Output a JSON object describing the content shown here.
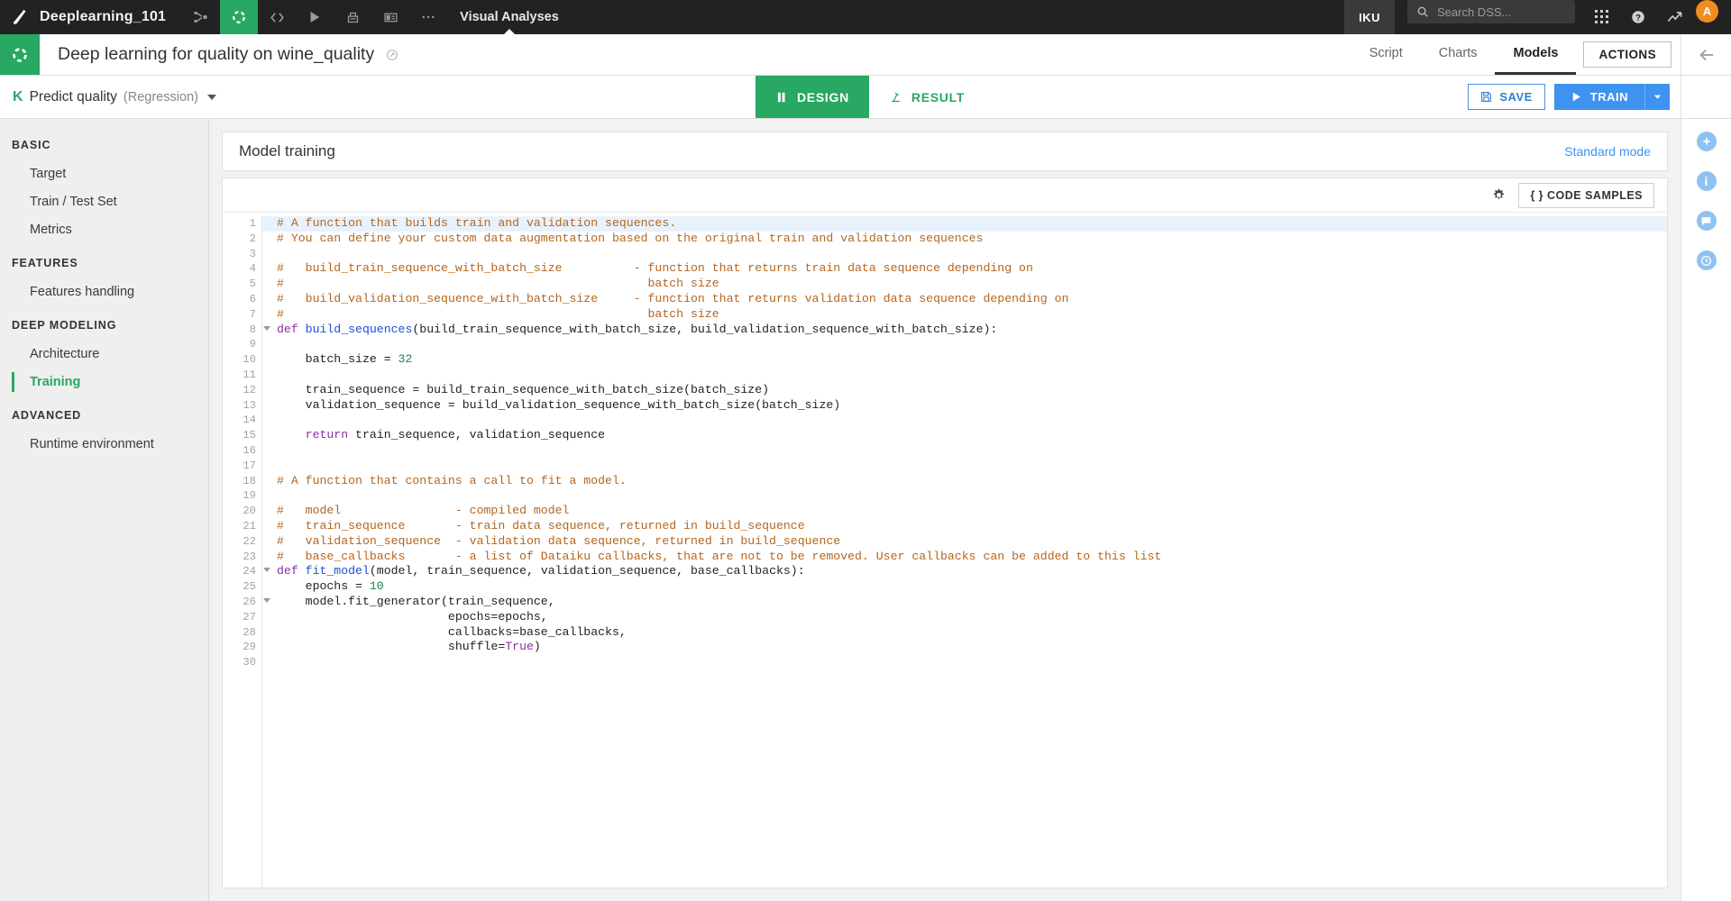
{
  "topbar": {
    "project_name": "Deeplearning_101",
    "section_label": "Visual Analyses",
    "iku_label": "IKU",
    "search_placeholder": "Search DSS...",
    "avatar_initial": "A",
    "icons": [
      "flow-icon",
      "analyses-icon",
      "code-icon",
      "jobs-icon",
      "notebooks-icon",
      "dashboards-icon",
      "more-icon"
    ]
  },
  "project_header": {
    "title": "Deep learning for quality on wine_quality",
    "tabs": [
      {
        "label": "Script",
        "active": false
      },
      {
        "label": "Charts",
        "active": false
      },
      {
        "label": "Models",
        "active": true
      }
    ],
    "actions_label": "ACTIONS"
  },
  "analysis_bar": {
    "k_badge": "K",
    "name": "Predict quality",
    "task_type": "(Regression)",
    "segments": [
      {
        "label": "DESIGN",
        "active": true
      },
      {
        "label": "RESULT",
        "active": false
      }
    ],
    "save_label": "SAVE",
    "train_label": "TRAIN"
  },
  "sidebar": {
    "groups": [
      {
        "title": "BASIC",
        "items": [
          {
            "label": "Target",
            "active": false
          },
          {
            "label": "Train / Test Set",
            "active": false
          },
          {
            "label": "Metrics",
            "active": false
          }
        ]
      },
      {
        "title": "FEATURES",
        "items": [
          {
            "label": "Features handling",
            "active": false
          }
        ]
      },
      {
        "title": "DEEP MODELING",
        "items": [
          {
            "label": "Architecture",
            "active": false
          },
          {
            "label": "Training",
            "active": true
          }
        ]
      },
      {
        "title": "ADVANCED",
        "items": [
          {
            "label": "Runtime environment",
            "active": false
          }
        ]
      }
    ]
  },
  "main": {
    "card_title": "Model training",
    "mode_link": "Standard mode",
    "code_samples_label": "{ } CODE SAMPLES"
  },
  "right_rail": {
    "icons": [
      "plus-icon",
      "info-icon",
      "comment-icon",
      "history-icon"
    ]
  },
  "editor": {
    "highlight_line": 1,
    "fold_lines": [
      8,
      24,
      26
    ],
    "total_lines": 30,
    "lines": [
      [
        {
          "t": "# A function that builds train and validation sequences.",
          "c": "cm"
        }
      ],
      [
        {
          "t": "# You can define your custom data augmentation based on the original train and validation sequences",
          "c": "cm"
        }
      ],
      [],
      [
        {
          "t": "#   build_train_sequence_with_batch_size          - function that returns train data sequence depending on",
          "c": "cm"
        }
      ],
      [
        {
          "t": "#                                                   batch size",
          "c": "cm"
        }
      ],
      [
        {
          "t": "#   build_validation_sequence_with_batch_size     - function that returns validation data sequence depending on",
          "c": "cm"
        }
      ],
      [
        {
          "t": "#                                                   batch size",
          "c": "cm"
        }
      ],
      [
        {
          "t": "def ",
          "c": "kw"
        },
        {
          "t": "build_sequences",
          "c": "fn"
        },
        {
          "t": "(build_train_sequence_with_batch_size, build_validation_sequence_with_batch_size):",
          "c": "op"
        }
      ],
      [],
      [
        {
          "t": "    batch_size = ",
          "c": "op"
        },
        {
          "t": "32",
          "c": "num"
        }
      ],
      [],
      [
        {
          "t": "    train_sequence = build_train_sequence_with_batch_size(batch_size)",
          "c": "op"
        }
      ],
      [
        {
          "t": "    validation_sequence = build_validation_sequence_with_batch_size(batch_size)",
          "c": "op"
        }
      ],
      [],
      [
        {
          "t": "    return",
          "c": "kw"
        },
        {
          "t": " train_sequence, validation_sequence",
          "c": "op"
        }
      ],
      [],
      [],
      [
        {
          "t": "# A function that contains a call to fit a model.",
          "c": "cm"
        }
      ],
      [],
      [
        {
          "t": "#   model                - compiled model",
          "c": "cm"
        }
      ],
      [
        {
          "t": "#   train_sequence       - train data sequence, returned in build_sequence",
          "c": "cm"
        }
      ],
      [
        {
          "t": "#   validation_sequence  - validation data sequence, returned in build_sequence",
          "c": "cm"
        }
      ],
      [
        {
          "t": "#   base_callbacks       - a list of Dataiku callbacks, that are not to be removed. User callbacks can be added to this list",
          "c": "cm"
        }
      ],
      [
        {
          "t": "def ",
          "c": "kw"
        },
        {
          "t": "fit_model",
          "c": "fn"
        },
        {
          "t": "(model, train_sequence, validation_sequence, base_callbacks):",
          "c": "op"
        }
      ],
      [
        {
          "t": "    epochs = ",
          "c": "op"
        },
        {
          "t": "10",
          "c": "num"
        }
      ],
      [
        {
          "t": "    model.fit_generator(train_sequence,",
          "c": "op"
        }
      ],
      [
        {
          "t": "                        epochs=epochs,",
          "c": "op"
        }
      ],
      [
        {
          "t": "                        callbacks=base_callbacks,",
          "c": "op"
        }
      ],
      [
        {
          "t": "                        shuffle=",
          "c": "op"
        },
        {
          "t": "True",
          "c": "kw"
        },
        {
          "t": ")",
          "c": "op"
        }
      ],
      []
    ]
  },
  "colors": {
    "green": "#28a862",
    "blue": "#3e92f0",
    "dark": "#222222",
    "comment": "#b5651d",
    "keyword": "#8b2ea8",
    "function": "#1a4fd6",
    "number": "#17834a",
    "highlight": "#e8f2fd"
  }
}
